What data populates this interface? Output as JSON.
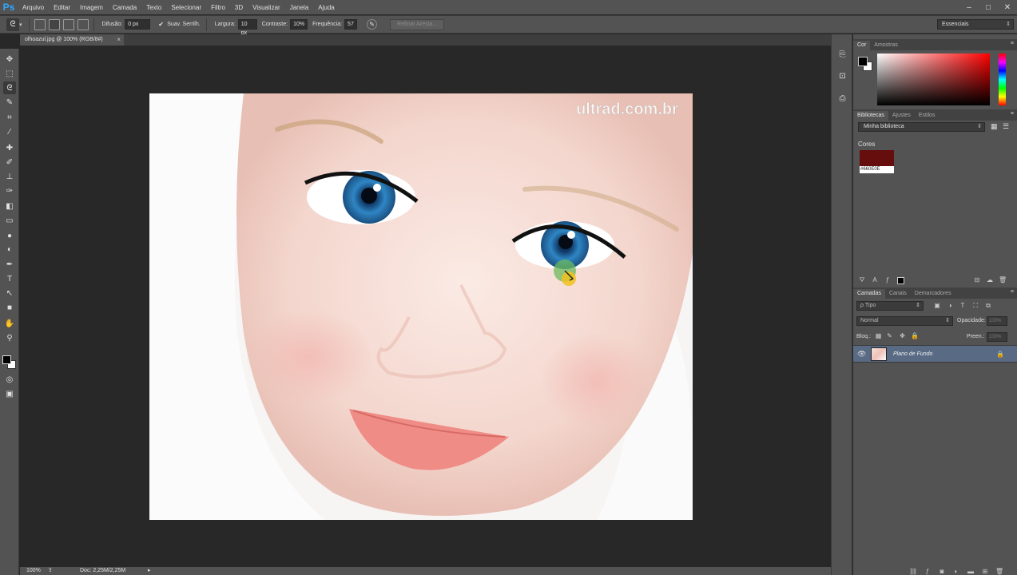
{
  "app": {
    "logo": "Ps"
  },
  "menu": [
    "Arquivo",
    "Editar",
    "Imagem",
    "Camada",
    "Texto",
    "Selecionar",
    "Filtro",
    "3D",
    "Visualizar",
    "Janela",
    "Ajuda"
  ],
  "window_controls": {
    "minimize": "–",
    "maximize": "□",
    "close": "✕"
  },
  "options": {
    "difusao_label": "Difusão:",
    "difusao_value": "0 px",
    "suav_label": "Suav. Serrilh.",
    "largura_label": "Largura:",
    "largura_value": "10 px",
    "contraste_label": "Contraste:",
    "contraste_value": "10%",
    "frequencia_label": "Frequência:",
    "frequencia_value": "57",
    "refine_button": "Refinar Aresta...",
    "workspace": "Essenciais"
  },
  "tools": [
    {
      "name": "move-tool",
      "glyph": "✥"
    },
    {
      "name": "marquee-tool",
      "glyph": "⬚"
    },
    {
      "name": "lasso-tool",
      "glyph": "ᘓ",
      "active": true
    },
    {
      "name": "quick-selection-tool",
      "glyph": "✎"
    },
    {
      "name": "crop-tool",
      "glyph": "⌗"
    },
    {
      "name": "eyedropper-tool",
      "glyph": "⁄"
    },
    {
      "name": "healing-brush-tool",
      "glyph": "✚"
    },
    {
      "name": "brush-tool",
      "glyph": "✐"
    },
    {
      "name": "clone-stamp-tool",
      "glyph": "⊥"
    },
    {
      "name": "history-brush-tool",
      "glyph": "✑"
    },
    {
      "name": "eraser-tool",
      "glyph": "◧"
    },
    {
      "name": "gradient-tool",
      "glyph": "▭"
    },
    {
      "name": "blur-tool",
      "glyph": "●"
    },
    {
      "name": "dodge-tool",
      "glyph": "◐"
    },
    {
      "name": "pen-tool",
      "glyph": "✒"
    },
    {
      "name": "type-tool",
      "glyph": "T"
    },
    {
      "name": "path-selection-tool",
      "glyph": "↖"
    },
    {
      "name": "shape-tool",
      "glyph": "■"
    },
    {
      "name": "hand-tool",
      "glyph": "✋"
    },
    {
      "name": "zoom-tool",
      "glyph": "⚲"
    },
    {
      "name": "quick-mask-tool",
      "glyph": "◎"
    },
    {
      "name": "screen-mode-tool",
      "glyph": "▣"
    }
  ],
  "document": {
    "tab_title": "olhoazul.jpg @ 100% (RGB/8#)",
    "close": "×",
    "watermark": "ultrad.com.br"
  },
  "status": {
    "zoom": "100%",
    "doc_info": "Doc: 2,25M/2,25M",
    "arrow": "▸"
  },
  "color_panel": {
    "tabs": [
      "Cor",
      "Amostras"
    ]
  },
  "libraries_panel": {
    "tabs": [
      "Bibliotecas",
      "Ajustes",
      "Estilos"
    ],
    "library": "Minha biblioteca",
    "section": "Cores",
    "swatch_hex": "#660E0E",
    "swatch_label": "#660E0E"
  },
  "layers_panel": {
    "tabs": [
      "Camadas",
      "Canais",
      "Demarcadores"
    ],
    "filter": "ρ Tipo",
    "blend_mode": "Normal",
    "opacity_label": "Opacidade:",
    "opacity_value": "100%",
    "lock_label": "Bloq.:",
    "fill_label": "Preen.:",
    "fill_value": "100%",
    "layer_name": "Plano de Fundo"
  },
  "colors": {
    "ui_bg": "#535353",
    "canvas_bg": "#282828",
    "layer_selected": "#596a85",
    "swatch": "#660E0E"
  }
}
